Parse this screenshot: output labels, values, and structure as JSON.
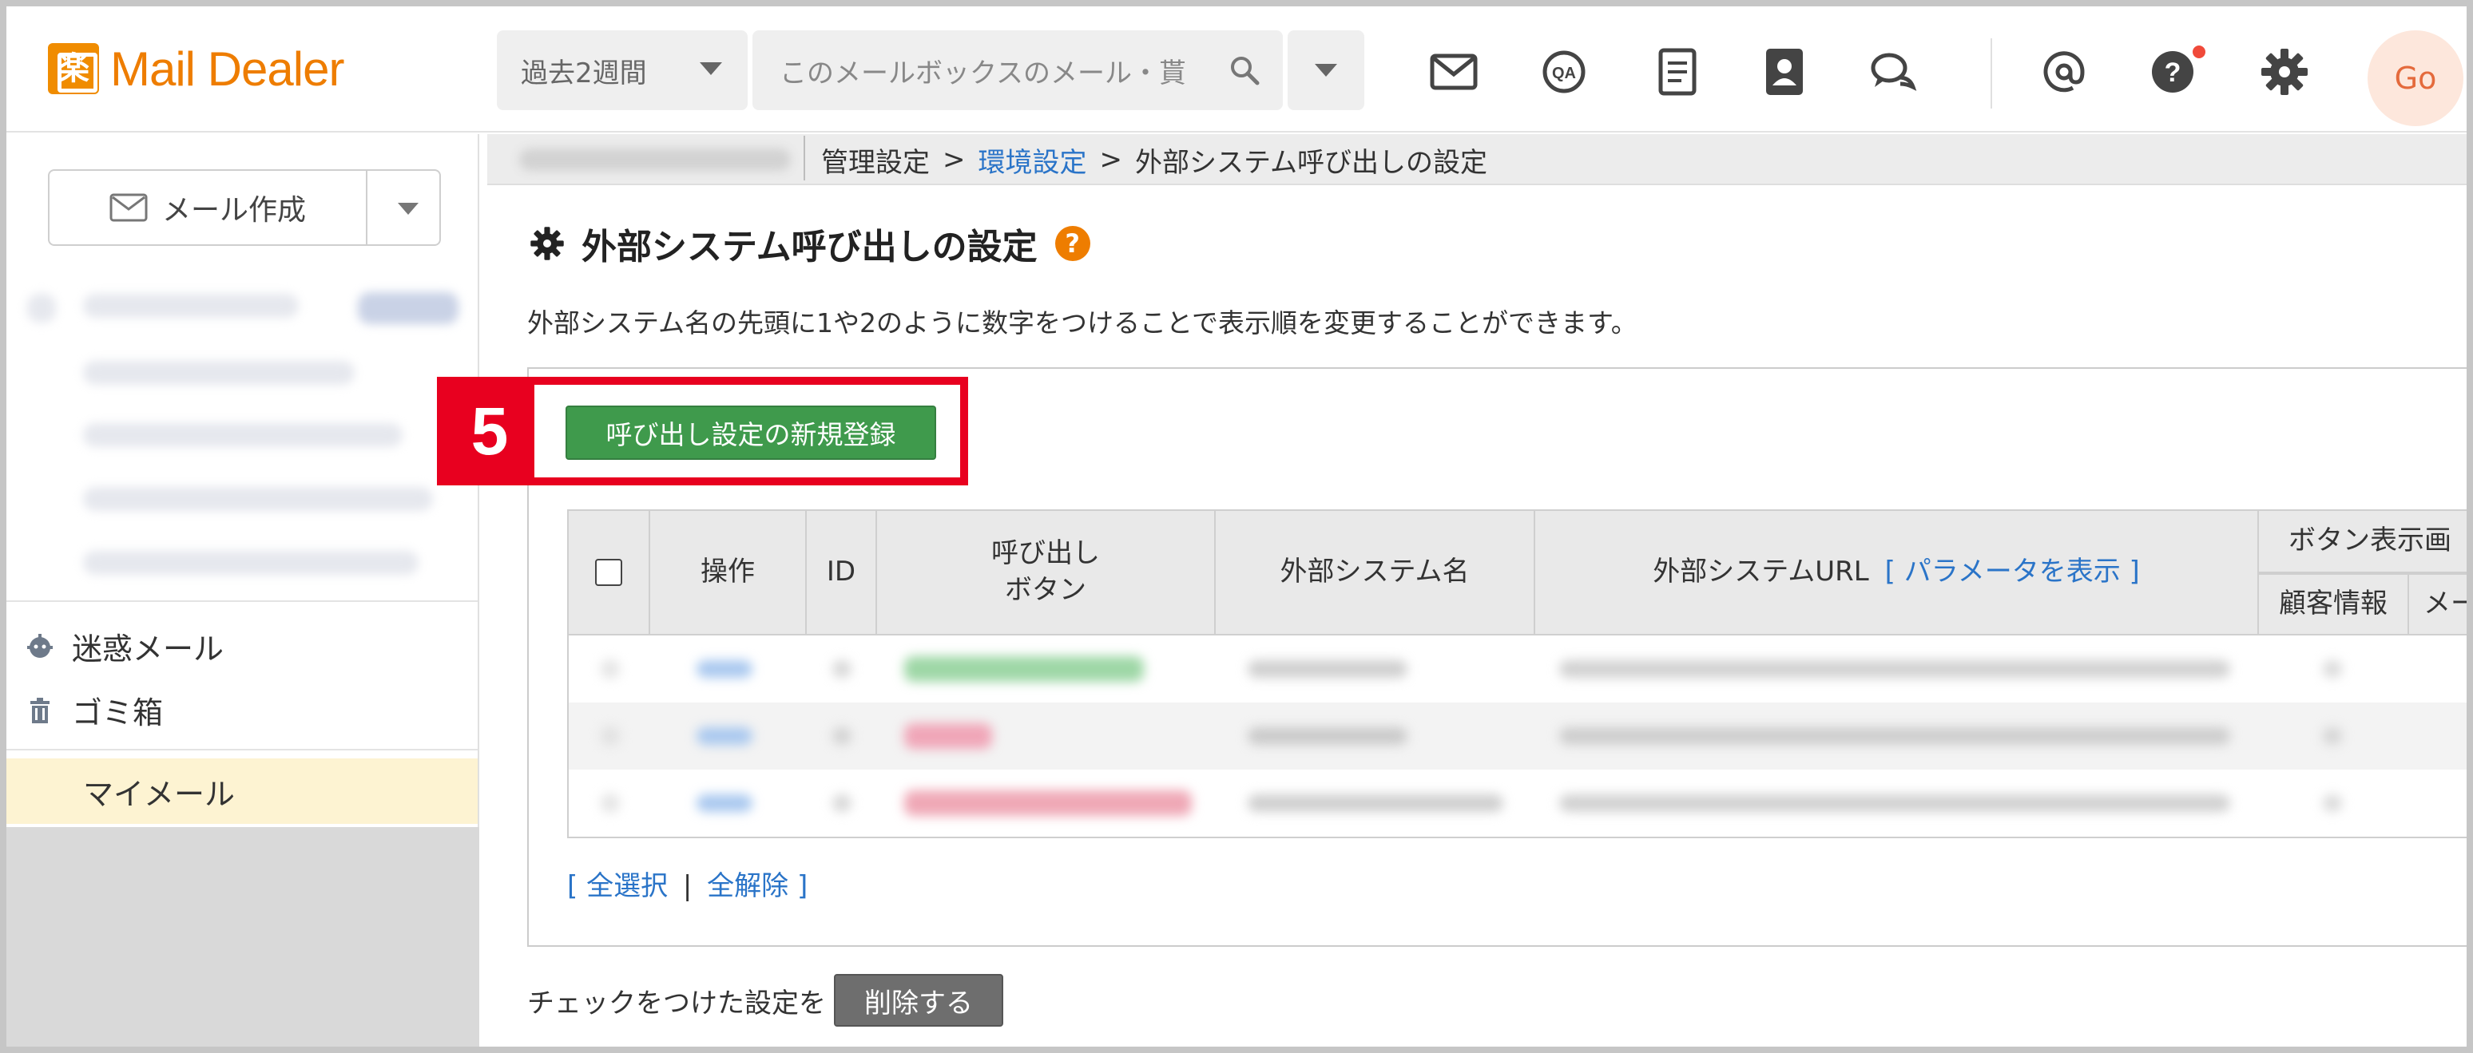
{
  "header": {
    "logo_text": "Mail Dealer",
    "logo_mark": "楽",
    "period": "過去2週間",
    "search_placeholder": "このメールボックスのメール・貰",
    "icons": [
      "mail-icon",
      "qa-icon",
      "document-icon",
      "address-book-icon",
      "chat-icon",
      "at-icon",
      "help-notification-icon",
      "gear-icon"
    ],
    "avatar": "Go",
    "brand_color": "#ee7d00"
  },
  "sidebar": {
    "compose_label": "メール作成",
    "spam_label": "迷惑メール",
    "trash_label": "ゴミ箱",
    "mymail_label": "マイメール"
  },
  "breadcrumb": {
    "item1": "管理設定",
    "item2": "環境設定",
    "item3": "外部システム呼び出しの設定",
    "arrow": ">"
  },
  "page": {
    "title": "外部システム呼び出しの設定",
    "help": "?",
    "description": "外部システム名の先頭に1や2のように数字をつけることで表示順を変更することができます。",
    "step_number": "5",
    "new_button": "呼び出し設定の新規登録",
    "highlight_color": "#e8001f",
    "button_color": "#3f9a4c"
  },
  "table": {
    "headers": {
      "operation": "操作",
      "id": "ID",
      "call_button_line1": "呼び出し",
      "call_button_line2": "ボタン",
      "system_name": "外部システム名",
      "system_url": "外部システムURL",
      "show_params": "[ パラメータを表示 ]",
      "button_display": "ボタン表示画",
      "customer_info": "顧客情報",
      "mail": "メー"
    }
  },
  "selection": {
    "open": "[",
    "select_all": "全選択",
    "divider": "|",
    "deselect_all": "全解除",
    "close": "]"
  },
  "footer": {
    "checked_label": "チェックをつけた設定を",
    "delete_button": "削除する"
  }
}
